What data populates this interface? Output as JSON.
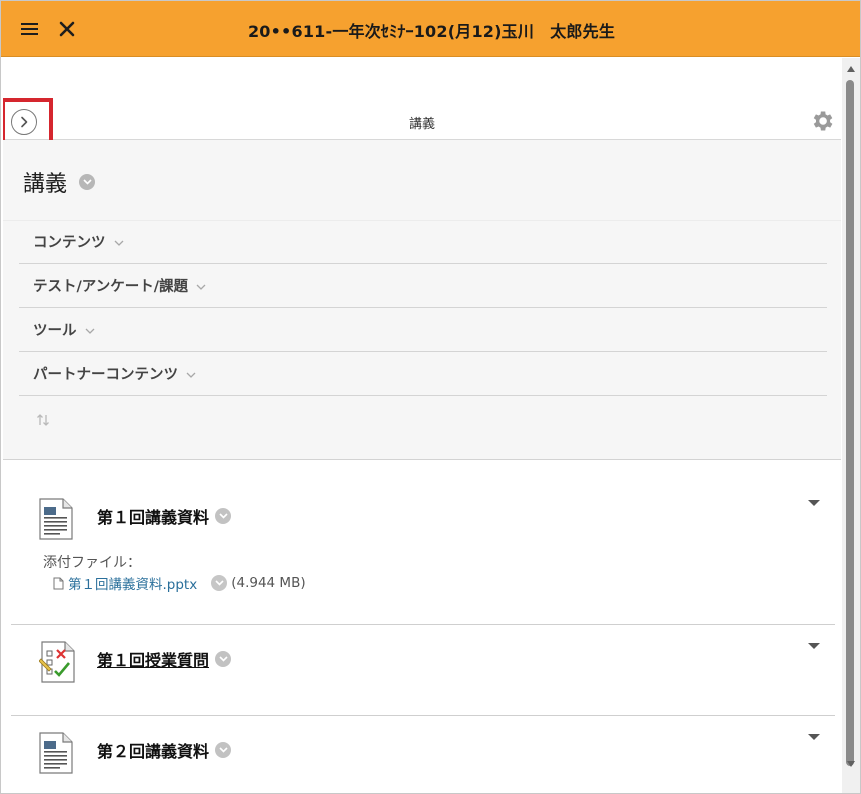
{
  "topbar": {
    "menu_icon": "hamburger-icon",
    "close_icon": "close-icon",
    "title": "20••611-一年次ｾﾐﾅｰ102(月12)玉川　太郎先生",
    "background": "#f6a12f"
  },
  "subheader": {
    "title": "講義",
    "expand_icon": "chevron-right-circle-icon",
    "settings_icon": "gear-icon"
  },
  "panel": {
    "title": "講義",
    "items": [
      {
        "label": "コンテンツ"
      },
      {
        "label": "テスト/アンケート/課題"
      },
      {
        "label": "ツール"
      },
      {
        "label": "パートナーコンテンツ"
      }
    ],
    "reorder_icon": "reorder-arrows-icon"
  },
  "items": [
    {
      "title": "第１回講義資料",
      "icon": "document-icon",
      "attachment_label": "添付ファイル：",
      "attachment_name": "第１回講義資料.pptx",
      "attachment_size": "(4.944 MB)"
    },
    {
      "title": "第１回授業質問",
      "icon": "survey-icon"
    },
    {
      "title": "第２回講義資料",
      "icon": "document-icon"
    }
  ],
  "colors": {
    "accent": "#f6a12f",
    "highlight": "#d5262e",
    "link": "#2a6f9b"
  }
}
